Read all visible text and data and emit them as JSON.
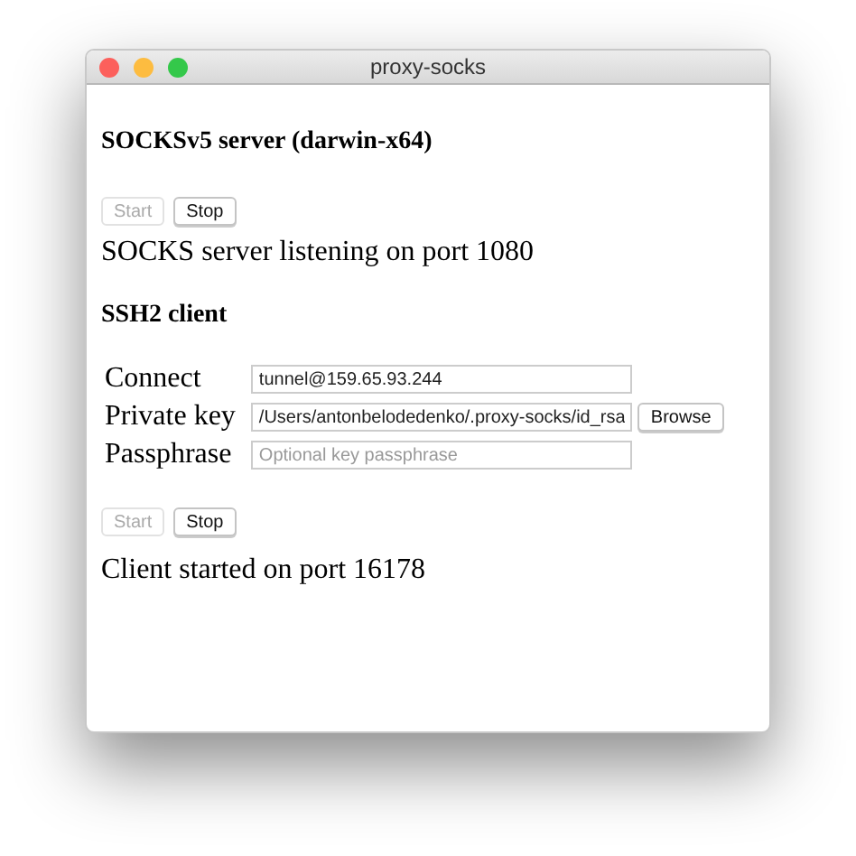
{
  "window": {
    "title": "proxy-socks"
  },
  "server": {
    "heading": "SOCKSv5 server (darwin-x64)",
    "buttons": [
      {
        "label": "Start",
        "disabled": true
      },
      {
        "label": "Stop",
        "disabled": false
      }
    ],
    "status": "SOCKS server listening on port 1080"
  },
  "client": {
    "heading": "SSH2 client",
    "fields": [
      {
        "label": "Connect",
        "value": "tunnel@159.65.93.244"
      },
      {
        "label": "Private key",
        "value": "/Users/antonbelodedenko/.proxy-socks/id_rsa",
        "button": "Browse"
      },
      {
        "label": "Passphrase",
        "placeholder": "Optional key passphrase"
      }
    ],
    "buttons": [
      {
        "label": "Start",
        "disabled": true
      },
      {
        "label": "Stop",
        "disabled": false
      }
    ],
    "status": "Client started on port 16178"
  }
}
